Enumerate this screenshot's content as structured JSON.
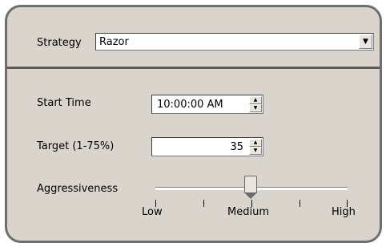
{
  "strategy": {
    "label": "Strategy",
    "selected": "Razor"
  },
  "start_time": {
    "label": "Start Time",
    "value": "10:00:00 AM"
  },
  "target": {
    "label": "Target (1-75%)",
    "value": "35"
  },
  "aggressiveness": {
    "label": "Aggressiveness",
    "low": "Low",
    "medium": "Medium",
    "high": "High",
    "level_fraction": 0.5
  },
  "icons": {
    "dropdown": "chevron-down-icon",
    "spin_up": "arrow-up-icon",
    "spin_down": "arrow-down-icon"
  }
}
